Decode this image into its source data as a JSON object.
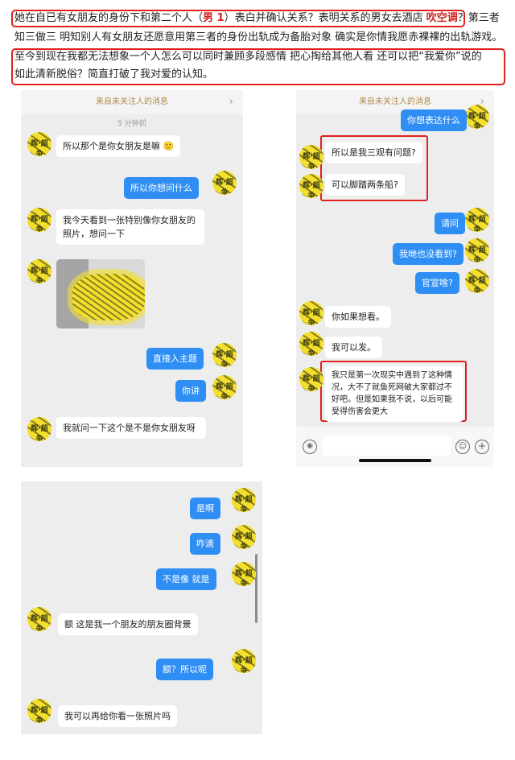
{
  "intro": {
    "line1_a": "她在自已有女朋友的身份下和第二个人（",
    "line1_bold": "男 1",
    "line1_b": "）表白并确认关系？表明关系的男女去酒店",
    "line1_red": "吹空调",
    "line1_c": "？第三者",
    "line2": "知三做三  明知别人有女朋友还愿意用第三者的身份出轨成为备胎对象  确实是你情我愿赤裸裸的出轨游戏。",
    "line3": "至今到现在我都无法想象一个人怎么可以同时兼顾多段感情  把心掏给其他人看  还可以把“我爱你”说的",
    "line4": "如此清新脱俗？简直打破了我对爱的认知。",
    "accent_color": "#e02020"
  },
  "avatar_text": "辉·超争",
  "panel1": {
    "notice": "来自未关注人的消息",
    "chevron": "›",
    "timestamp": "5 分钟前",
    "messages": [
      {
        "side": "in",
        "text": "所以那个是你女朋友是嘛 🙂"
      },
      {
        "side": "out",
        "text": "所以你想问什么"
      },
      {
        "side": "in",
        "text": "我今天看到一张特别像你女朋友的照片，想问一下"
      },
      {
        "side": "out",
        "text": "直接入主题"
      },
      {
        "side": "out",
        "text": "你讲"
      },
      {
        "side": "in",
        "text": "我就问一下这个是不是你女朋友呀"
      }
    ]
  },
  "panel2": {
    "notice": "来自未关注人的消息",
    "chevron": "›",
    "messages": [
      {
        "side": "out",
        "text": "你想表达什么"
      },
      {
        "side": "in",
        "text": "所以是我三观有问题?"
      },
      {
        "side": "in",
        "text": "可以脚踏两条船?"
      },
      {
        "side": "out",
        "text": "请问"
      },
      {
        "side": "out",
        "text": "我哋也没看到?"
      },
      {
        "side": "out",
        "text": "官宣啥?"
      },
      {
        "side": "in",
        "text": "你如果想看。"
      },
      {
        "side": "in",
        "text": "我可以发。"
      },
      {
        "side": "in",
        "text": "我只是第一次现实中遇到了这种情况，大不了就鱼死网破大家都过不好吧。但是如果我不说，以后可能受得伤害会更大"
      }
    ],
    "icons": {
      "voice": "voice-icon",
      "emoji": "emoji-icon",
      "plus": "plus-icon"
    }
  },
  "panel3": {
    "messages": [
      {
        "side": "out",
        "text": "是啊"
      },
      {
        "side": "out",
        "text": "咋滴"
      },
      {
        "side": "out",
        "text": "不是像 就是"
      },
      {
        "side": "in",
        "text": "额 这是我一个朋友的朋友圈背景"
      },
      {
        "side": "out",
        "text": "额？所以呢"
      },
      {
        "side": "in",
        "text": "我可以再给你看一张照片吗"
      }
    ]
  }
}
